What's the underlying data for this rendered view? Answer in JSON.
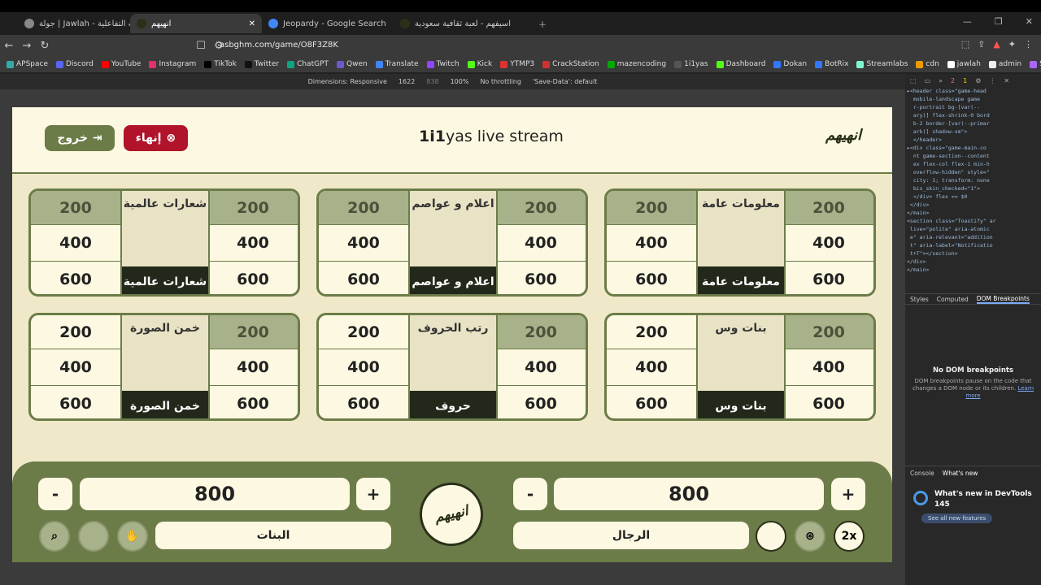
{
  "browser": {
    "tabs": [
      {
        "title": "جولة | Jawlah - منصة الألعاب التفاعلية",
        "active": false
      },
      {
        "title": "انهيهم",
        "active": true
      },
      {
        "title": "Jeopardy - Google Search",
        "active": false
      },
      {
        "title": "اسيفهم - لعبة ثقافية سعودية",
        "active": false
      }
    ],
    "url": "asbghm.com/game/O8F3Z8K",
    "bookmarks": [
      "APSpace",
      "Discord",
      "YouTube",
      "Instagram",
      "TikTok",
      "Twitter",
      "ChatGPT",
      "Qwen",
      "Translate",
      "Twitch",
      "Kick",
      "YTMP3",
      "CrackStation",
      "mazencoding",
      "1i1yas",
      "Dashboard",
      "Dokan",
      "BotRix",
      "Streamlabs",
      "cdn",
      "jawlah",
      "admin",
      "Spacemail"
    ],
    "devbar": {
      "dimensions": "Dimensions: Responsive",
      "width": "1622",
      "height": "838",
      "zoom": "100%",
      "throttle": "No throttling",
      "savedata": "'Save-Data': default"
    }
  },
  "game": {
    "logo": "انهيهم",
    "title_bold": "1i1",
    "title_rest": "yas live stream",
    "exit_label": "خروج",
    "end_label": "إنهاء",
    "categories": [
      {
        "name": "معلومات عامة",
        "img_text": "معلومات عامة",
        "left": [
          "200",
          "400",
          "600"
        ],
        "right": [
          "200",
          "400",
          "600"
        ],
        "used_left": [
          true,
          false,
          false
        ],
        "used_right": [
          true,
          false,
          false
        ]
      },
      {
        "name": "اعلام و عواصم",
        "img_text": "اعلام و عواصم",
        "left": [
          "200",
          "400",
          "600"
        ],
        "right": [
          "200",
          "400",
          "600"
        ],
        "used_left": [
          true,
          false,
          false
        ],
        "used_right": [
          true,
          false,
          false
        ]
      },
      {
        "name": "شعارات عالمية",
        "img_text": "شعارات عالمية",
        "left": [
          "200",
          "400",
          "600"
        ],
        "right": [
          "200",
          "400",
          "600"
        ],
        "used_left": [
          true,
          false,
          false
        ],
        "used_right": [
          true,
          false,
          false
        ]
      },
      {
        "name": "بنات وس",
        "img_text": "بنات وس",
        "left": [
          "200",
          "400",
          "600"
        ],
        "right": [
          "200",
          "400",
          "600"
        ],
        "used_left": [
          false,
          false,
          false
        ],
        "used_right": [
          true,
          false,
          false
        ]
      },
      {
        "name": "حروف",
        "img_text": "رتب الحروف",
        "left": [
          "200",
          "400",
          "600"
        ],
        "right": [
          "200",
          "400",
          "600"
        ],
        "used_left": [
          false,
          false,
          false
        ],
        "used_right": [
          true,
          false,
          false
        ]
      },
      {
        "name": "خمن الصورة",
        "img_text": "خمن الصورة",
        "left": [
          "200",
          "400",
          "600"
        ],
        "right": [
          "200",
          "400",
          "600"
        ],
        "used_left": [
          false,
          false,
          false
        ],
        "used_right": [
          true,
          false,
          false
        ]
      }
    ],
    "teams": [
      {
        "name": "البنات",
        "score": "800"
      },
      {
        "name": "الرجال",
        "score": "800"
      }
    ],
    "minus": "-",
    "plus": "+",
    "double_label": "2x"
  },
  "devtools": {
    "tabs": [
      "Styles",
      "Computed",
      "DOM Breakpoints"
    ],
    "nodom_title": "No DOM breakpoints",
    "nodom_text": "DOM breakpoints pause on the code that changes a DOM node or its children.",
    "learn_more": "Learn more",
    "drawer_tabs": [
      "Console",
      "What's new"
    ],
    "news_title": "What's new in DevTools 145",
    "see_all": "See all new features",
    "errors": "2",
    "warnings": "1"
  },
  "colors": {
    "olive": "#6b7c48",
    "cream": "#fdf8e1",
    "red": "#b0132a",
    "dark": "#22291a"
  }
}
